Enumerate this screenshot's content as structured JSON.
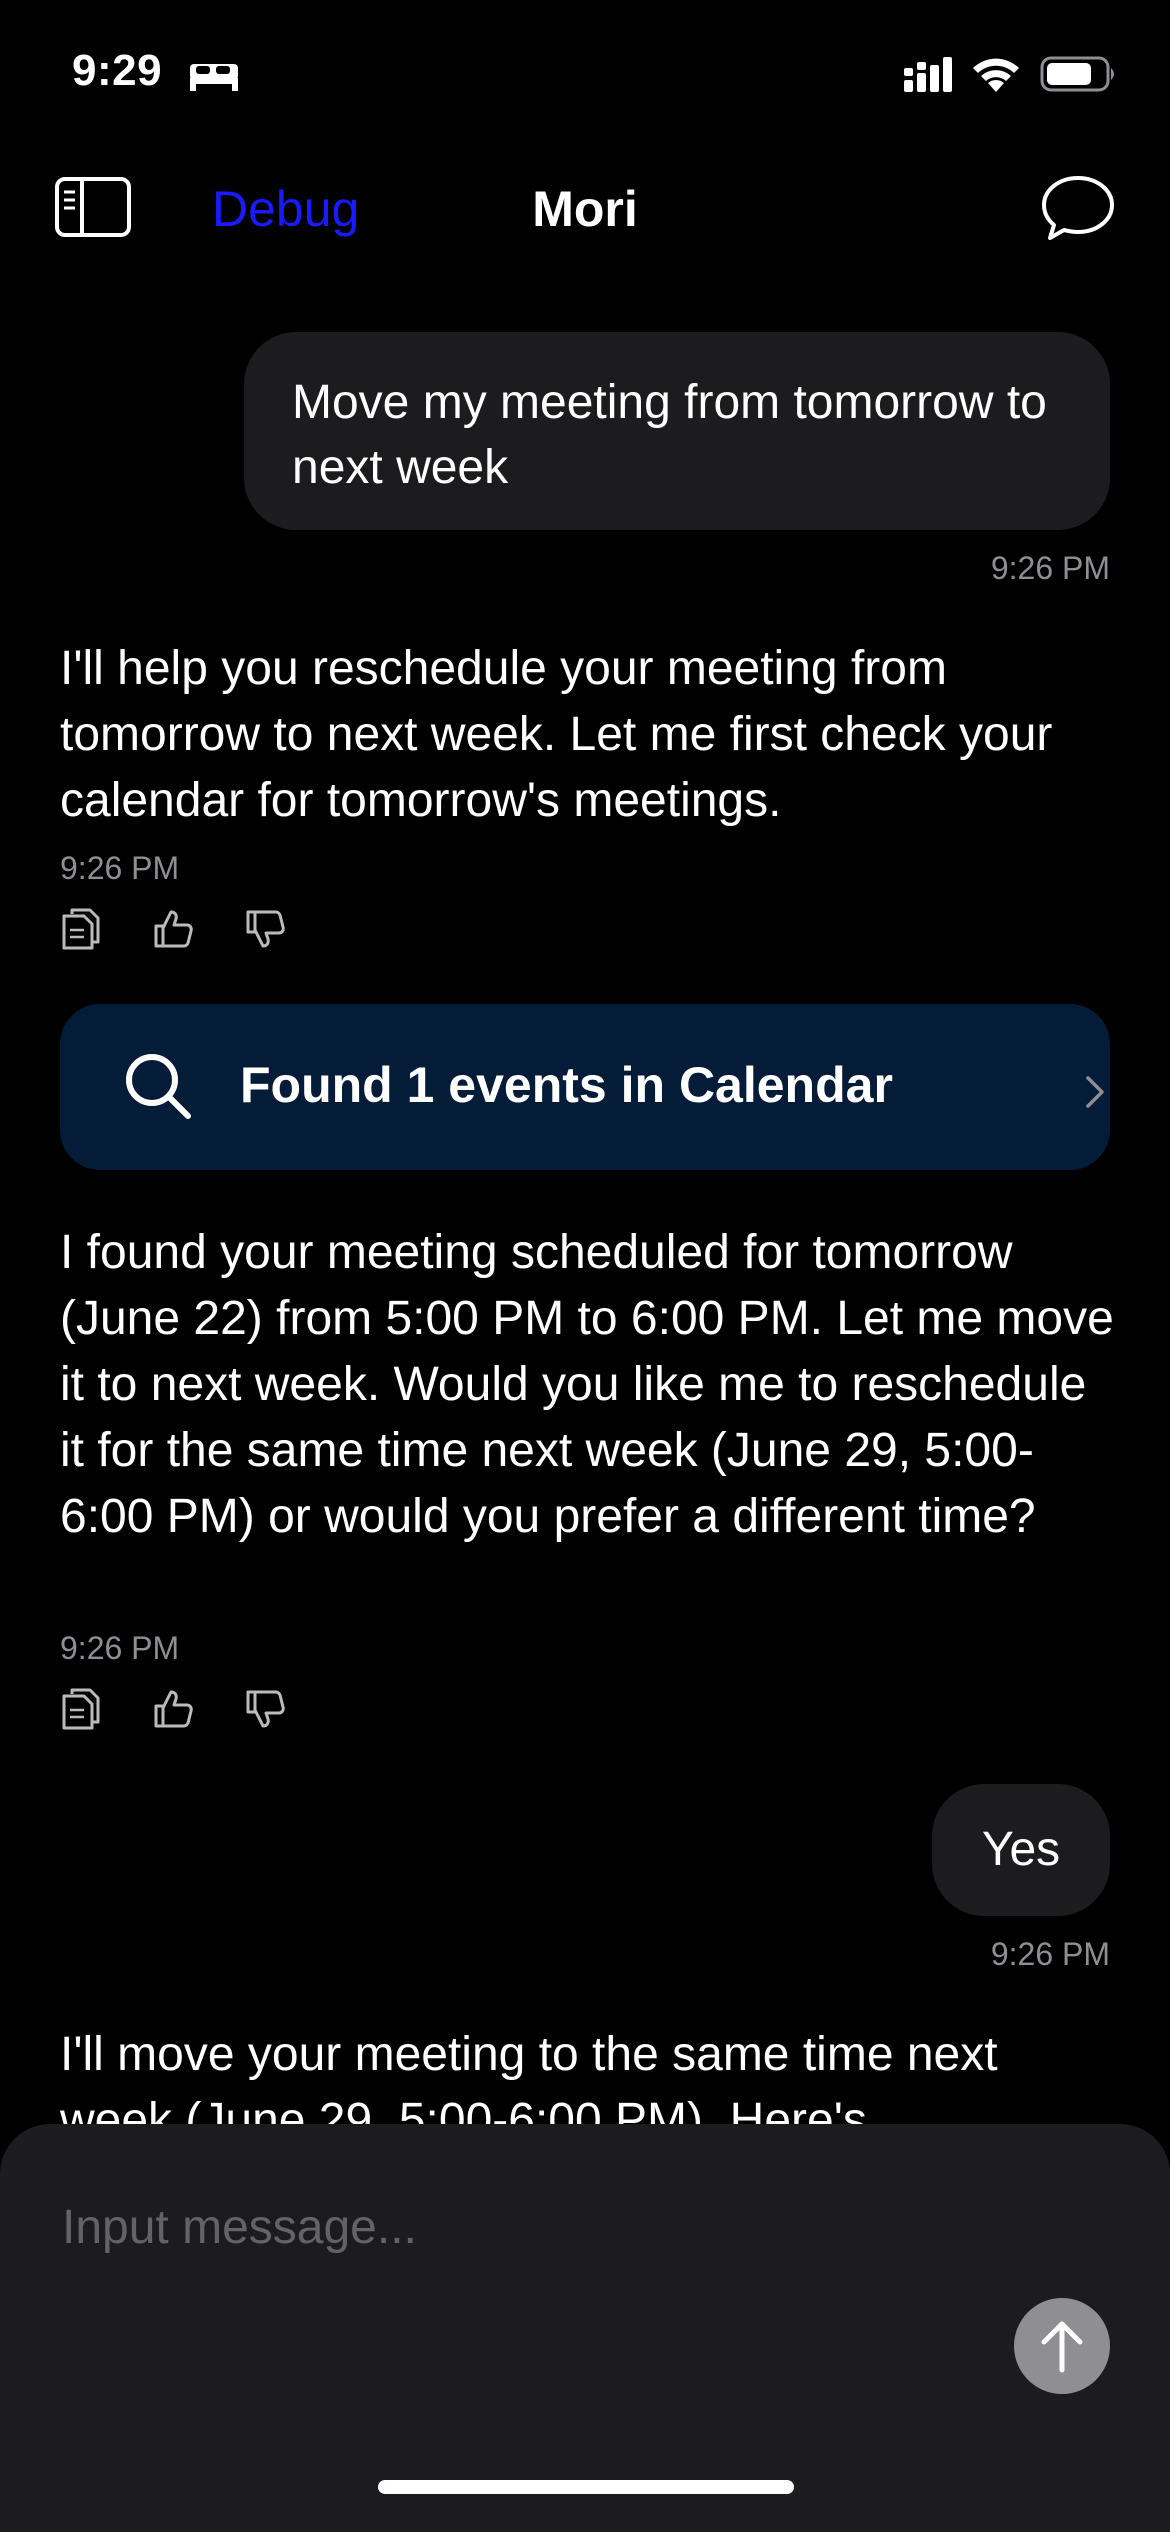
{
  "status_bar": {
    "time": "9:29"
  },
  "nav": {
    "debug_label": "Debug",
    "title": "Mori"
  },
  "messages": [
    {
      "role": "user",
      "text": "Move my meeting from tomorrow to next week",
      "time": "9:26 PM"
    },
    {
      "role": "assistant",
      "text": "I'll help you reschedule your meeting from tomorrow to next week. Let me first check your calendar for tomorrow's meetings.",
      "time": "9:26 PM"
    },
    {
      "role": "tool",
      "label": "Found 1 events in Calendar"
    },
    {
      "role": "assistant",
      "text": "I found your meeting scheduled for tomorrow (June 22) from 5:00 PM to 6:00 PM. Let me move it to next week. Would you like me to reschedule it for the same time next week (June 29, 5:00-6:00 PM) or would you prefer a different time?",
      "time": "9:26 PM"
    },
    {
      "role": "user",
      "text": "Yes",
      "time": "9:26 PM"
    },
    {
      "role": "assistant",
      "text": "I'll move your meeting to the same time next week (June 29, 5:00-6:00 PM). Here's"
    }
  ],
  "composer": {
    "placeholder": "Input message..."
  },
  "colors": {
    "background": "#000000",
    "user_bubble": "#1c1c1e",
    "tool_card": "#051c38",
    "debug_link": "#1a1aff",
    "timestamp": "#8e8e93",
    "send_button": "#8e8e93"
  },
  "icons": [
    "bed-icon",
    "signal-icon",
    "wifi-icon",
    "battery-icon",
    "sidebar-icon",
    "chat-bubble-icon",
    "copy-icon",
    "thumbs-up-icon",
    "thumbs-down-icon",
    "search-icon",
    "chevron-right-icon",
    "arrow-up-icon"
  ]
}
